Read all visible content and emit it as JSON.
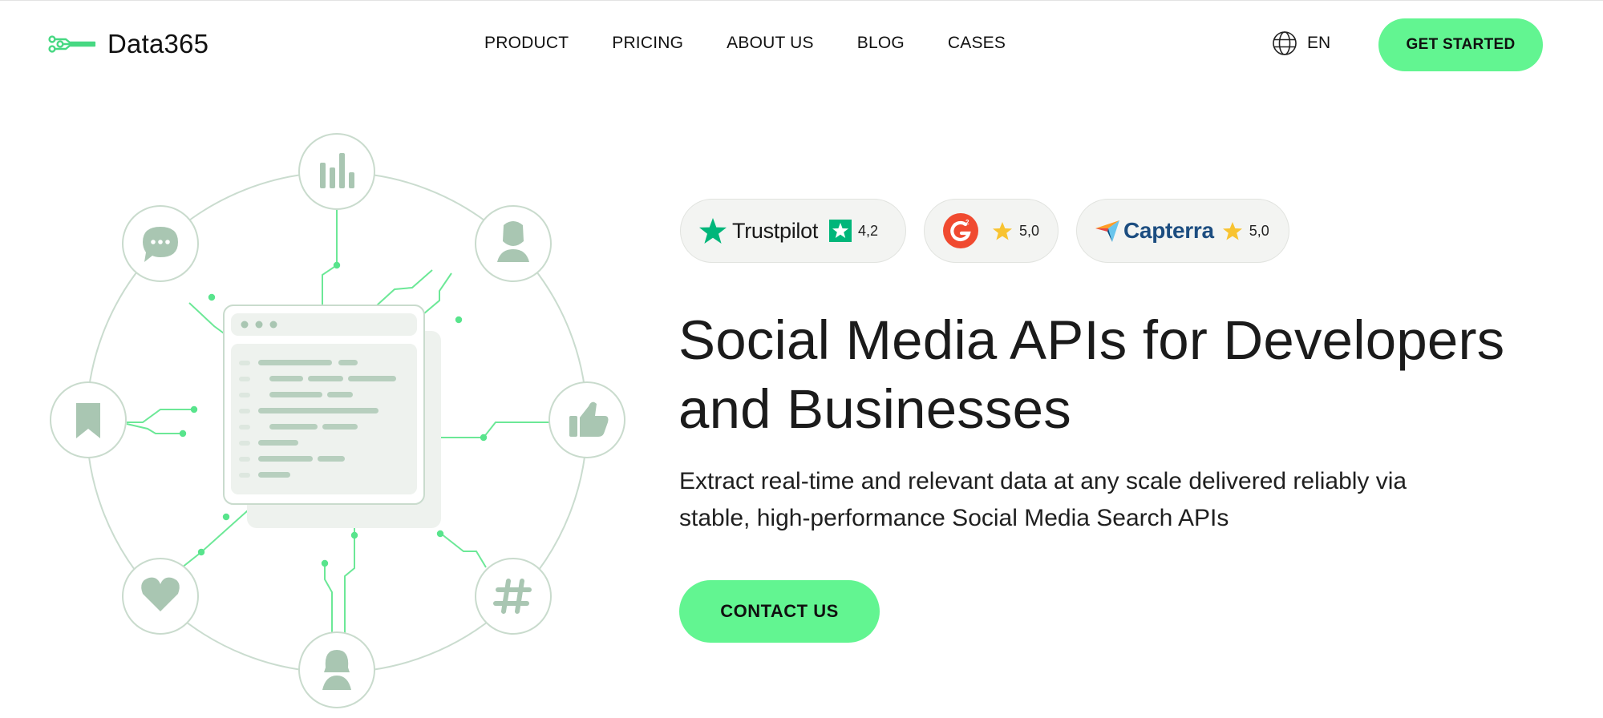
{
  "brand": {
    "name": "Data365"
  },
  "nav": {
    "items": [
      "PRODUCT",
      "PRICING",
      "ABOUT US",
      "BLOG",
      "CASES"
    ]
  },
  "language": {
    "code": "EN"
  },
  "header": {
    "cta_label": "GET STARTED"
  },
  "ratings": {
    "trustpilot": {
      "name": "Trustpilot",
      "score": "4,2"
    },
    "g2": {
      "score": "5,0"
    },
    "capterra": {
      "name": "Capterra",
      "score": "5,0"
    }
  },
  "hero": {
    "title_line1": "Social Media APIs for Developers",
    "title_line2": "and Businesses",
    "subtitle_line1": "Extract real-time and relevant data at any scale delivered reliably via",
    "subtitle_line2": "stable, high-performance Social Media Search APIs",
    "cta_label": "CONTACT US"
  },
  "colors": {
    "accent": "#62f591",
    "icon_fill": "#a9c6b2",
    "line": "#c8dccd",
    "connector": "#62e892"
  },
  "icons": {
    "center": "code-window-icon",
    "orbit": [
      "bar-chart-icon",
      "user-icon",
      "thumbs-up-icon",
      "hashtag-icon",
      "woman-icon",
      "heart-icon",
      "bookmark-icon",
      "chat-icon"
    ]
  }
}
